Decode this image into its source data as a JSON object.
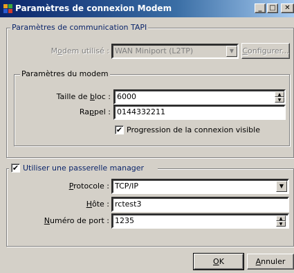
{
  "window": {
    "title": "Paramètres de connexion Modem"
  },
  "tapi": {
    "legend": "Paramètres de communication TAPI",
    "modem_label_pre": "M",
    "modem_label_u": "o",
    "modem_label_post": "dem utilisé :",
    "modem_value": "WAN Miniport (L2TP)",
    "configure_pre": "",
    "configure_u": "C",
    "configure_post": "onfigurer..."
  },
  "modem": {
    "legend": "Paramètres du modem",
    "block_label_pre": "Taille de ",
    "block_label_u": "b",
    "block_label_post": "loc :",
    "block_value": "6000",
    "callback_label_pre": "Ra",
    "callback_label_u": "p",
    "callback_label_post": "pel :",
    "callback_value": "0144332211",
    "progress_label": "Progression de la connexion visible",
    "progress_checked": true
  },
  "manager": {
    "legend": "Utiliser une passerelle manager",
    "enabled": true,
    "protocol_label_pre": "",
    "protocol_label_u": "P",
    "protocol_label_post": "rotocole :",
    "protocol_value": "TCP/IP",
    "host_label_pre": "",
    "host_label_u": "H",
    "host_label_post": "ôte :",
    "host_value": "rctest3",
    "port_label_pre": "",
    "port_label_u": "N",
    "port_label_post": "uméro de port :",
    "port_value": "1235"
  },
  "buttons": {
    "ok_u": "O",
    "ok_post": "K",
    "cancel_u": "A",
    "cancel_post": "nnuler"
  },
  "check_mark": "✔"
}
